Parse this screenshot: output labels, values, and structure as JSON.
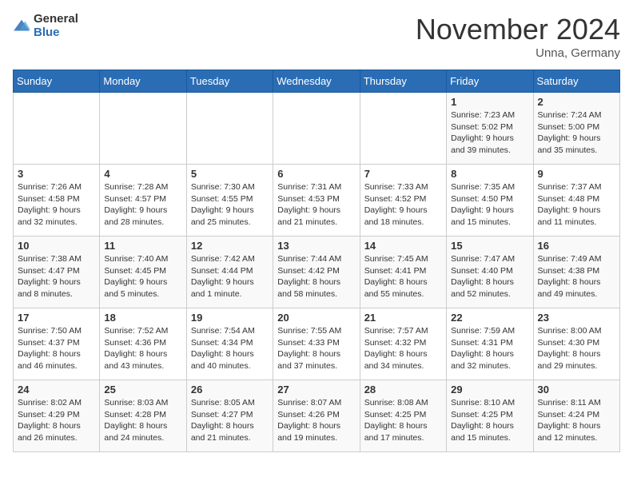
{
  "logo": {
    "general": "General",
    "blue": "Blue"
  },
  "title": "November 2024",
  "location": "Unna, Germany",
  "weekdays": [
    "Sunday",
    "Monday",
    "Tuesday",
    "Wednesday",
    "Thursday",
    "Friday",
    "Saturday"
  ],
  "weeks": [
    [
      {
        "day": "",
        "info": ""
      },
      {
        "day": "",
        "info": ""
      },
      {
        "day": "",
        "info": ""
      },
      {
        "day": "",
        "info": ""
      },
      {
        "day": "",
        "info": ""
      },
      {
        "day": "1",
        "info": "Sunrise: 7:23 AM\nSunset: 5:02 PM\nDaylight: 9 hours and 39 minutes."
      },
      {
        "day": "2",
        "info": "Sunrise: 7:24 AM\nSunset: 5:00 PM\nDaylight: 9 hours and 35 minutes."
      }
    ],
    [
      {
        "day": "3",
        "info": "Sunrise: 7:26 AM\nSunset: 4:58 PM\nDaylight: 9 hours and 32 minutes."
      },
      {
        "day": "4",
        "info": "Sunrise: 7:28 AM\nSunset: 4:57 PM\nDaylight: 9 hours and 28 minutes."
      },
      {
        "day": "5",
        "info": "Sunrise: 7:30 AM\nSunset: 4:55 PM\nDaylight: 9 hours and 25 minutes."
      },
      {
        "day": "6",
        "info": "Sunrise: 7:31 AM\nSunset: 4:53 PM\nDaylight: 9 hours and 21 minutes."
      },
      {
        "day": "7",
        "info": "Sunrise: 7:33 AM\nSunset: 4:52 PM\nDaylight: 9 hours and 18 minutes."
      },
      {
        "day": "8",
        "info": "Sunrise: 7:35 AM\nSunset: 4:50 PM\nDaylight: 9 hours and 15 minutes."
      },
      {
        "day": "9",
        "info": "Sunrise: 7:37 AM\nSunset: 4:48 PM\nDaylight: 9 hours and 11 minutes."
      }
    ],
    [
      {
        "day": "10",
        "info": "Sunrise: 7:38 AM\nSunset: 4:47 PM\nDaylight: 9 hours and 8 minutes."
      },
      {
        "day": "11",
        "info": "Sunrise: 7:40 AM\nSunset: 4:45 PM\nDaylight: 9 hours and 5 minutes."
      },
      {
        "day": "12",
        "info": "Sunrise: 7:42 AM\nSunset: 4:44 PM\nDaylight: 9 hours and 1 minute."
      },
      {
        "day": "13",
        "info": "Sunrise: 7:44 AM\nSunset: 4:42 PM\nDaylight: 8 hours and 58 minutes."
      },
      {
        "day": "14",
        "info": "Sunrise: 7:45 AM\nSunset: 4:41 PM\nDaylight: 8 hours and 55 minutes."
      },
      {
        "day": "15",
        "info": "Sunrise: 7:47 AM\nSunset: 4:40 PM\nDaylight: 8 hours and 52 minutes."
      },
      {
        "day": "16",
        "info": "Sunrise: 7:49 AM\nSunset: 4:38 PM\nDaylight: 8 hours and 49 minutes."
      }
    ],
    [
      {
        "day": "17",
        "info": "Sunrise: 7:50 AM\nSunset: 4:37 PM\nDaylight: 8 hours and 46 minutes."
      },
      {
        "day": "18",
        "info": "Sunrise: 7:52 AM\nSunset: 4:36 PM\nDaylight: 8 hours and 43 minutes."
      },
      {
        "day": "19",
        "info": "Sunrise: 7:54 AM\nSunset: 4:34 PM\nDaylight: 8 hours and 40 minutes."
      },
      {
        "day": "20",
        "info": "Sunrise: 7:55 AM\nSunset: 4:33 PM\nDaylight: 8 hours and 37 minutes."
      },
      {
        "day": "21",
        "info": "Sunrise: 7:57 AM\nSunset: 4:32 PM\nDaylight: 8 hours and 34 minutes."
      },
      {
        "day": "22",
        "info": "Sunrise: 7:59 AM\nSunset: 4:31 PM\nDaylight: 8 hours and 32 minutes."
      },
      {
        "day": "23",
        "info": "Sunrise: 8:00 AM\nSunset: 4:30 PM\nDaylight: 8 hours and 29 minutes."
      }
    ],
    [
      {
        "day": "24",
        "info": "Sunrise: 8:02 AM\nSunset: 4:29 PM\nDaylight: 8 hours and 26 minutes."
      },
      {
        "day": "25",
        "info": "Sunrise: 8:03 AM\nSunset: 4:28 PM\nDaylight: 8 hours and 24 minutes."
      },
      {
        "day": "26",
        "info": "Sunrise: 8:05 AM\nSunset: 4:27 PM\nDaylight: 8 hours and 21 minutes."
      },
      {
        "day": "27",
        "info": "Sunrise: 8:07 AM\nSunset: 4:26 PM\nDaylight: 8 hours and 19 minutes."
      },
      {
        "day": "28",
        "info": "Sunrise: 8:08 AM\nSunset: 4:25 PM\nDaylight: 8 hours and 17 minutes."
      },
      {
        "day": "29",
        "info": "Sunrise: 8:10 AM\nSunset: 4:25 PM\nDaylight: 8 hours and 15 minutes."
      },
      {
        "day": "30",
        "info": "Sunrise: 8:11 AM\nSunset: 4:24 PM\nDaylight: 8 hours and 12 minutes."
      }
    ]
  ]
}
